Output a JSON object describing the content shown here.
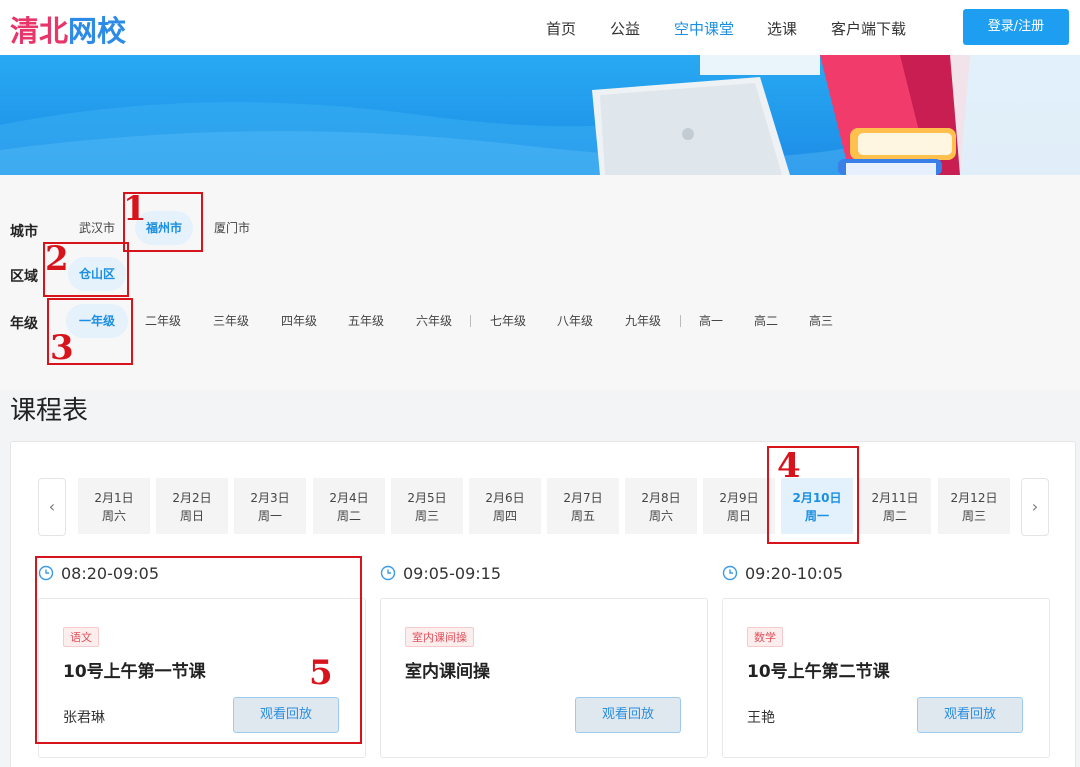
{
  "header": {
    "logo_chars": [
      "清",
      "北",
      "网",
      "校"
    ],
    "nav": [
      "首页",
      "公益",
      "空中课堂",
      "选课",
      "客户端下载"
    ],
    "active_nav": "空中课堂",
    "login_label": "登录/注册",
    "accent": "#1e9ef0"
  },
  "filters": {
    "city_label": "城市",
    "cities": [
      "武汉市",
      "福州市",
      "厦门市"
    ],
    "selected_city": "福州市",
    "district_label": "区域",
    "districts": [
      "仓山区"
    ],
    "selected_district": "仓山区",
    "grade_label": "年级",
    "grades": [
      "一年级",
      "二年级",
      "三年级",
      "四年级",
      "五年级",
      "六年级",
      "七年级",
      "八年级",
      "九年级",
      "高一",
      "高二",
      "高三"
    ],
    "selected_grade": "一年级"
  },
  "schedule": {
    "title": "课程表",
    "prev_icon": "‹",
    "next_icon": "›",
    "days": [
      {
        "date": "2月1日",
        "weekday": "周六"
      },
      {
        "date": "2月2日",
        "weekday": "周日"
      },
      {
        "date": "2月3日",
        "weekday": "周一"
      },
      {
        "date": "2月4日",
        "weekday": "周二"
      },
      {
        "date": "2月5日",
        "weekday": "周三"
      },
      {
        "date": "2月6日",
        "weekday": "周四"
      },
      {
        "date": "2月7日",
        "weekday": "周五"
      },
      {
        "date": "2月8日",
        "weekday": "周六"
      },
      {
        "date": "2月9日",
        "weekday": "周日"
      },
      {
        "date": "2月10日",
        "weekday": "周一"
      },
      {
        "date": "2月11日",
        "weekday": "周二"
      },
      {
        "date": "2月12日",
        "weekday": "周三"
      }
    ],
    "selected_day": "2月10日",
    "courses": [
      {
        "time": "08:20-09:05",
        "tag": "语文",
        "title": "10号上午第一节课",
        "teacher": "张君琳",
        "button": "观看回放"
      },
      {
        "time": "09:05-09:15",
        "tag": "室内课间操",
        "title": "室内课间操",
        "teacher": "",
        "button": "观看回放"
      },
      {
        "time": "09:20-10:05",
        "tag": "数学",
        "title": "10号上午第二节课",
        "teacher": "王艳",
        "button": "观看回放"
      }
    ]
  },
  "annotations": [
    "1",
    "2",
    "3",
    "4",
    "5"
  ],
  "annotation_color": "#d7141c"
}
